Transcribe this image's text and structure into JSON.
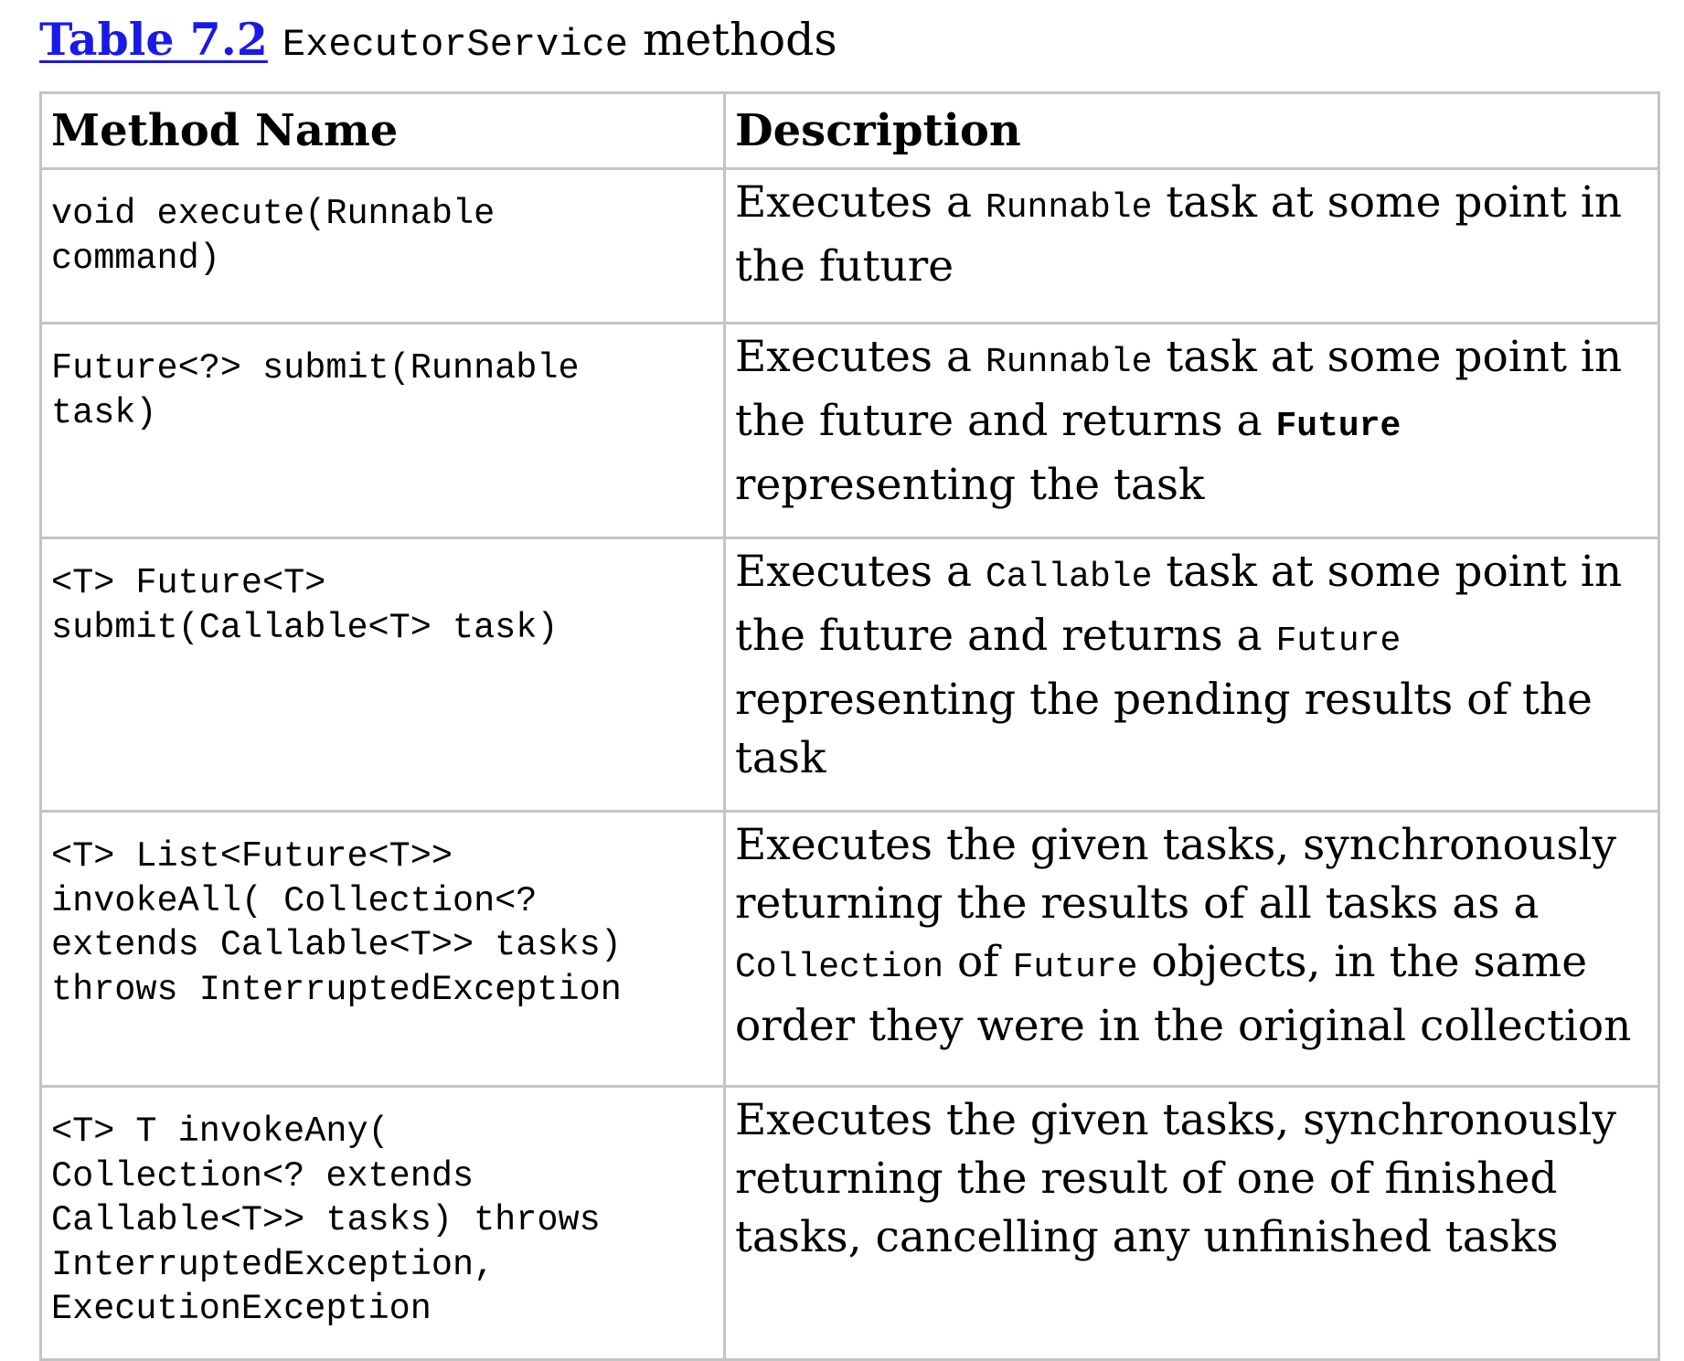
{
  "caption": {
    "link": "Table 7.2",
    "code": "ExecutorService",
    "text": "methods"
  },
  "headers": {
    "method": "Method Name",
    "description": "Description"
  },
  "rows": [
    {
      "method": "void execute(Runnable\ncommand)",
      "desc": [
        {
          "t": "Executes a ",
          "s": "text"
        },
        {
          "t": "Runnable",
          "s": "code"
        },
        {
          "t": " task at some point in the future",
          "s": "text"
        }
      ]
    },
    {
      "method": "Future<?> submit(Runnable\ntask)",
      "desc": [
        {
          "t": "Executes a ",
          "s": "text"
        },
        {
          "t": "Runnable",
          "s": "code"
        },
        {
          "t": " task at some point in the future and returns a ",
          "s": "text"
        },
        {
          "t": "Future",
          "s": "code-b"
        },
        {
          "t": " representing the task",
          "s": "text"
        }
      ]
    },
    {
      "method": "<T> Future<T>\nsubmit(Callable<T> task)",
      "desc": [
        {
          "t": "Executes a ",
          "s": "text"
        },
        {
          "t": "Callable",
          "s": "code"
        },
        {
          "t": " task at some point in the future and returns a ",
          "s": "text"
        },
        {
          "t": "Future",
          "s": "code"
        },
        {
          "t": " representing the pending results of the task",
          "s": "text"
        }
      ]
    },
    {
      "method": "<T> List<Future<T>>\ninvokeAll( Collection<?\nextends Callable<T>> tasks)\nthrows InterruptedException",
      "desc": [
        {
          "t": "Executes the given tasks, synchronously returning the results of all tasks as a ",
          "s": "text"
        },
        {
          "t": "Collection",
          "s": "code"
        },
        {
          "t": " of ",
          "s": "text"
        },
        {
          "t": "Future",
          "s": "code"
        },
        {
          "t": " objects, in the same order they were in the original collection",
          "s": "text"
        }
      ]
    },
    {
      "method": "<T> T invokeAny(\nCollection<? extends\nCallable<T>> tasks) throws\nInterruptedException,\nExecutionException",
      "desc": [
        {
          "t": "Executes the given tasks, synchronously returning the result of one of finished tasks, cancelling any unfinished tasks",
          "s": "text"
        }
      ]
    }
  ]
}
